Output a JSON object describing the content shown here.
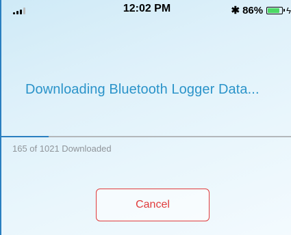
{
  "status_bar": {
    "time": "12:02 PM",
    "bluetooth_icon": "bluetooth-icon",
    "battery_percent": "86%",
    "battery_level": 0.86,
    "signal_icon": "cellular-signal-icon",
    "charging_icon": "charging-bolt-icon"
  },
  "download": {
    "title": "Downloading Bluetooth Logger Data...",
    "progress_text": "165 of 1021 Downloaded",
    "progress_fraction": 0.162
  },
  "actions": {
    "cancel_label": "Cancel"
  },
  "colors": {
    "title": "#2a93c9",
    "progress": "#2a7fc0",
    "cancel": "#e03a3a",
    "battery": "#4cd964"
  }
}
